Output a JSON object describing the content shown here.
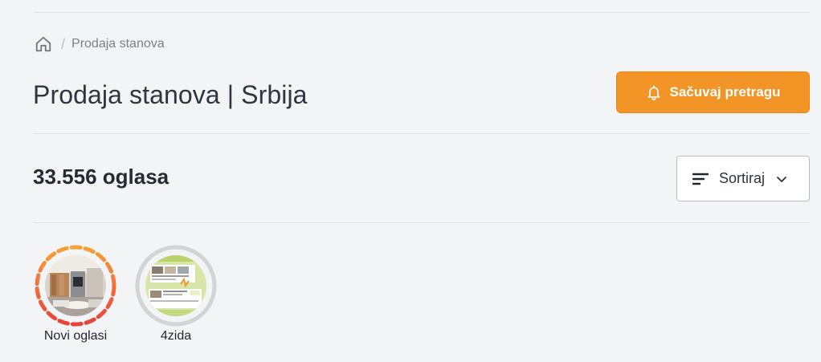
{
  "breadcrumb": {
    "home_icon": "home-icon",
    "current": "Prodaja stanova"
  },
  "header": {
    "title": "Prodaja stanova | Srbija",
    "save_search_label": "Sačuvaj pretragu",
    "save_search_icon": "bell-icon",
    "accent_color": "#f39426"
  },
  "results": {
    "count_label": "33.556 oglasa",
    "sort_label": "Sortiraj",
    "sort_icon": "sort-lines-icon"
  },
  "stories": [
    {
      "label": "Novi oglasi",
      "ring": "dashed-gradient-orange-red"
    },
    {
      "label": "4zida",
      "ring": "solid-gray"
    }
  ]
}
